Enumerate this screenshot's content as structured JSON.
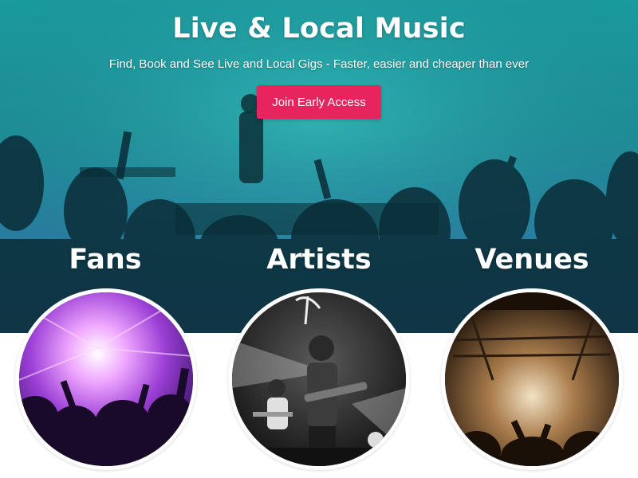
{
  "hero": {
    "title": "Live & Local Music",
    "subtitle": "Find, Book and See Live and Local Gigs - Faster, easier and cheaper than ever",
    "cta_label": "Join Early Access"
  },
  "sections": [
    {
      "heading": "Fans",
      "image": "crowd-purple-lights-photo"
    },
    {
      "heading": "Artists",
      "image": "band-performing-photo"
    },
    {
      "heading": "Venues",
      "image": "venue-stage-photo"
    }
  ],
  "colors": {
    "hero_teal": "#1a9a9c",
    "hero_blue": "#2f6fa3",
    "cta": "#e8245e",
    "text": "#ffffff"
  }
}
